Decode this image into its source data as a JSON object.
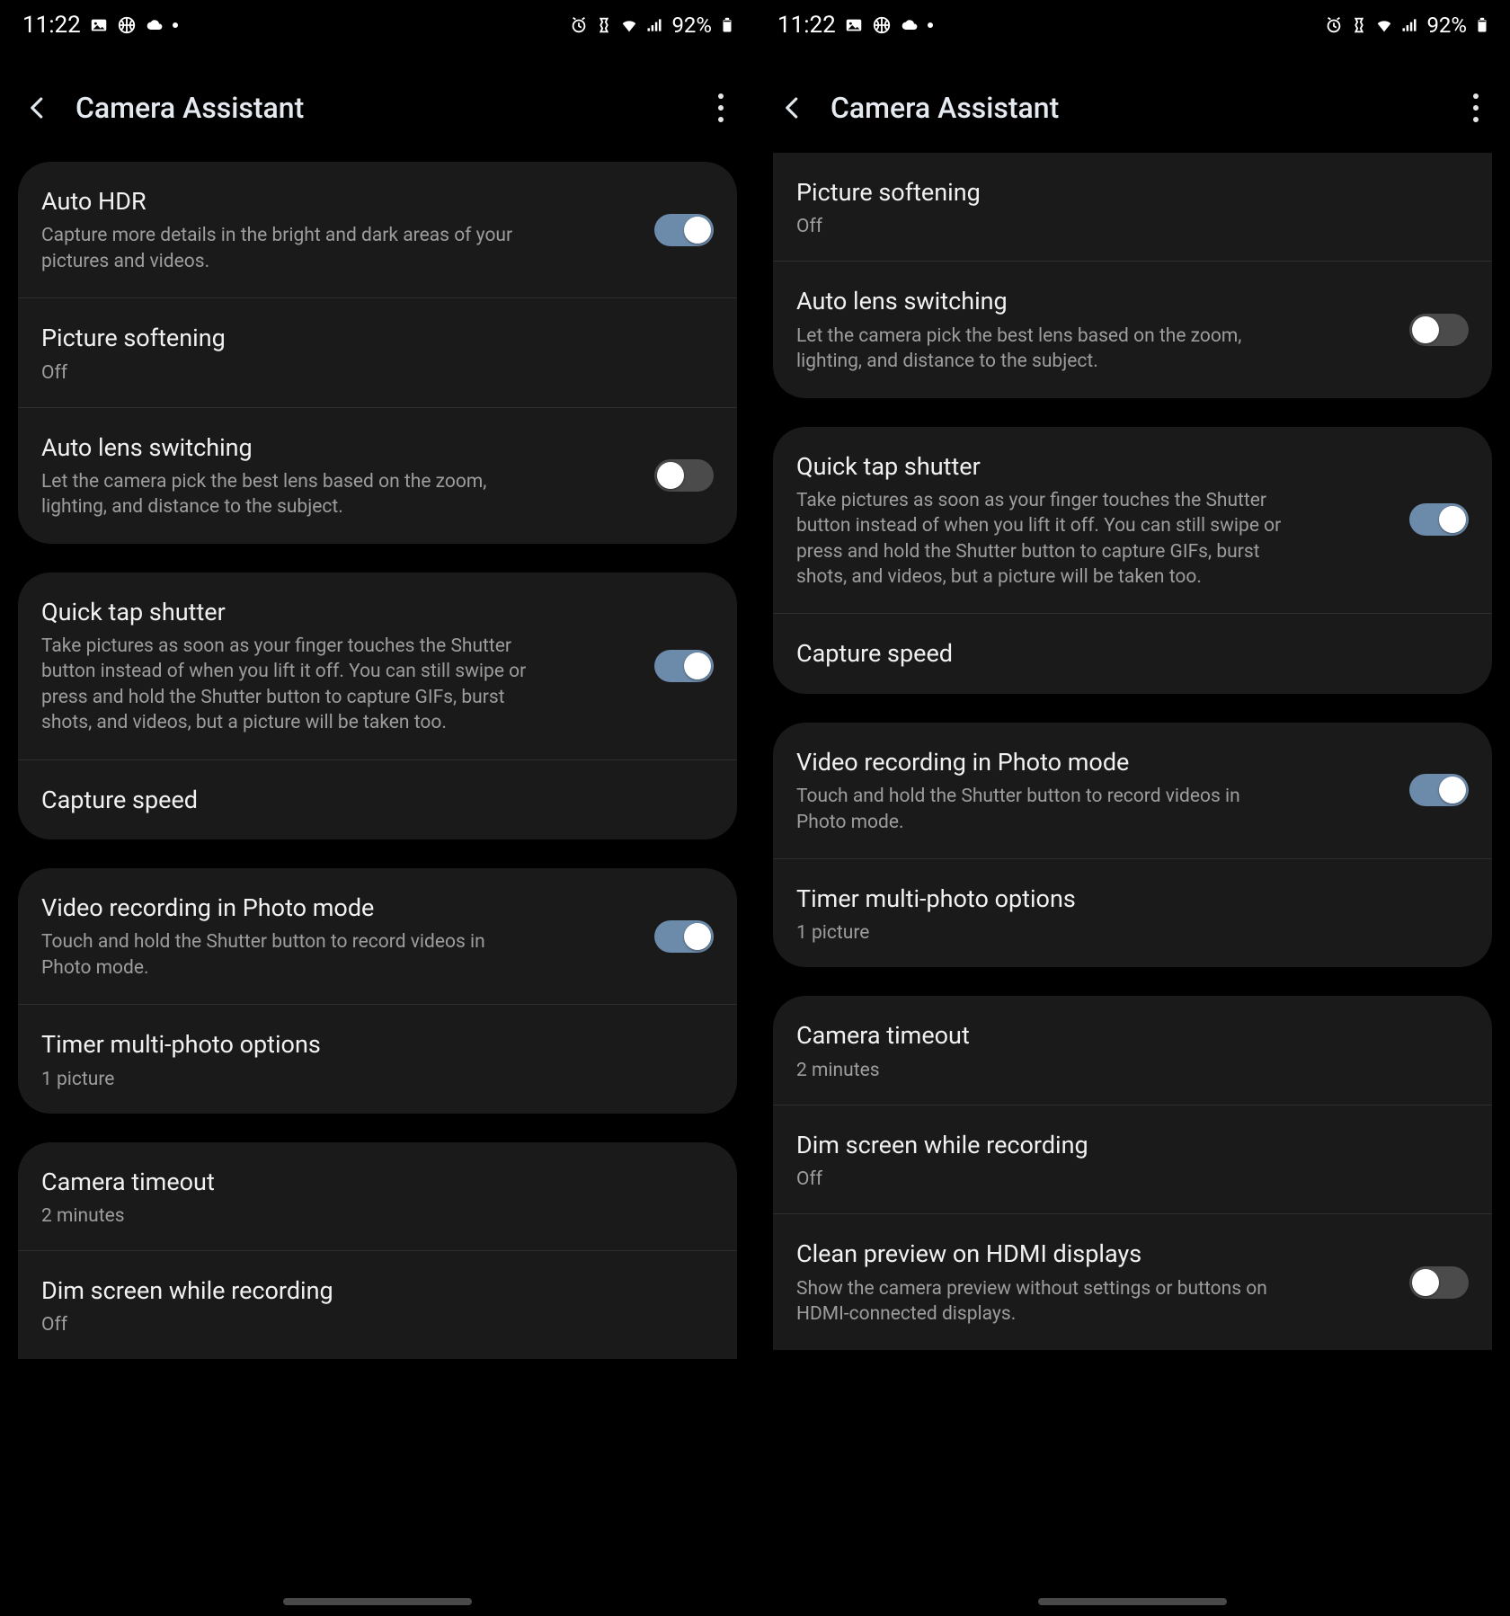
{
  "status": {
    "time": "11:22",
    "battery_pct": "92%"
  },
  "app": {
    "title": "Camera Assistant"
  },
  "L": {
    "g1": {
      "auto_hdr": {
        "title": "Auto HDR",
        "desc": "Capture more details in the bright and dark areas of your pictures and videos."
      },
      "pic_soft": {
        "title": "Picture softening",
        "value": "Off"
      },
      "auto_lens": {
        "title": "Auto lens switching",
        "desc": "Let the camera pick the best lens based on the zoom, lighting, and distance to the subject."
      }
    },
    "g2": {
      "quick_tap": {
        "title": "Quick tap shutter",
        "desc": "Take pictures as soon as your finger touches the Shutter button instead of when you lift it off. You can still swipe or press and hold the Shutter button to capture GIFs, burst shots, and videos, but a picture will be taken too."
      },
      "cap_speed": {
        "title": "Capture speed"
      }
    },
    "g3": {
      "vid_photo": {
        "title": "Video recording in Photo mode",
        "desc": "Touch and hold the Shutter button to record videos in Photo mode."
      },
      "timer_multi": {
        "title": "Timer multi-photo options",
        "value": "1 picture"
      }
    },
    "g4": {
      "cam_timeout": {
        "title": "Camera timeout",
        "value": "2 minutes"
      },
      "dim_rec": {
        "title": "Dim screen while recording",
        "value": "Off"
      }
    }
  },
  "R": {
    "g1": {
      "pic_soft": {
        "title": "Picture softening",
        "value": "Off"
      },
      "auto_lens": {
        "title": "Auto lens switching",
        "desc": "Let the camera pick the best lens based on the zoom, lighting, and distance to the subject."
      }
    },
    "g2": {
      "quick_tap": {
        "title": "Quick tap shutter",
        "desc": "Take pictures as soon as your finger touches the Shutter button instead of when you lift it off. You can still swipe or press and hold the Shutter button to capture GIFs, burst shots, and videos, but a picture will be taken too."
      },
      "cap_speed": {
        "title": "Capture speed"
      }
    },
    "g3": {
      "vid_photo": {
        "title": "Video recording in Photo mode",
        "desc": "Touch and hold the Shutter button to record videos in Photo mode."
      },
      "timer_multi": {
        "title": "Timer multi-photo options",
        "value": "1 picture"
      }
    },
    "g4": {
      "cam_timeout": {
        "title": "Camera timeout",
        "value": "2 minutes"
      },
      "dim_rec": {
        "title": "Dim screen while recording",
        "value": "Off"
      },
      "clean_hdmi": {
        "title": "Clean preview on HDMI displays",
        "desc": "Show the camera preview without settings or buttons on HDMI-connected displays."
      }
    }
  }
}
